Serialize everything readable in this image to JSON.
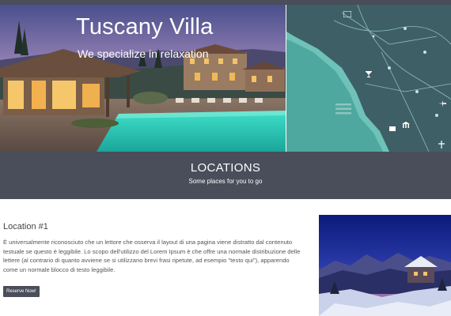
{
  "hero": {
    "title": "Tuscany Villa",
    "subtitle": "We specialize in relaxation"
  },
  "map": {
    "icons": [
      "cocktail-icon",
      "building-icon",
      "airplane-icon",
      "monument-icon",
      "landmark-icon",
      "tower-icon",
      "menu-icon"
    ]
  },
  "locations_band": {
    "title": "LOCATIONS",
    "subtitle": "Some places for you to go"
  },
  "location": {
    "heading": "Location #1",
    "text": "È universalmente riconosciuto che un lettore che osserva il layout di una pagina viene distratto dal contenuto testuale se questo è leggibile. Lo scopo dell'utilizzo del Lorem Ipsum è che offre una normale distribuzione delle lettere (al contrario di quanto avviene se si utilizzano brevi frasi ripetute, ad esempio \"testo qui\"), apparendo come un normale blocco di testo leggibile.",
    "button_label": "Reserve Now!"
  },
  "colors": {
    "band": "#4a4d5a",
    "map_sea": "#4fa8a0",
    "map_land": "#3f5f66"
  }
}
